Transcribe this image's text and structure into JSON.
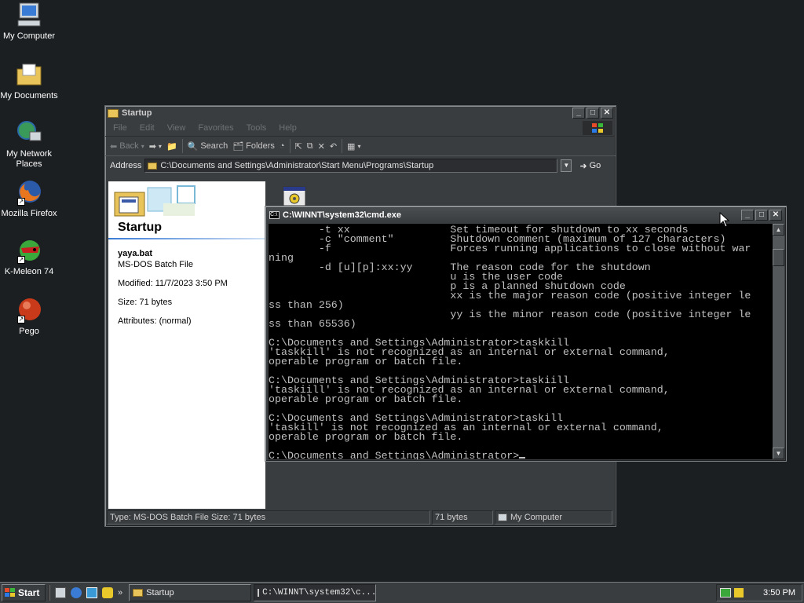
{
  "desktop": {
    "icons": [
      {
        "label": "My Computer"
      },
      {
        "label": "My Documents"
      },
      {
        "label": "My Network Places"
      },
      {
        "label": "Mozilla Firefox"
      },
      {
        "label": "K-Meleon 74"
      },
      {
        "label": "Pego"
      }
    ]
  },
  "explorer": {
    "title": "Startup",
    "menu": [
      "File",
      "Edit",
      "View",
      "Favorites",
      "Tools",
      "Help"
    ],
    "toolbar": {
      "back": "Back",
      "search": "Search",
      "folders": "Folders"
    },
    "address_label": "Address",
    "address_value": "C:\\Documents and Settings\\Administrator\\Start Menu\\Programs\\Startup",
    "go_label": "Go",
    "pane": {
      "folder_title": "Startup",
      "file_name": "yaya.bat",
      "file_type": "MS-DOS Batch File",
      "modified": "Modified: 11/7/2023 3:50 PM",
      "size": "Size: 71 bytes",
      "attributes": "Attributes: (normal)"
    },
    "status": {
      "description": "Type: MS-DOS Batch File Size: 71 bytes",
      "size": "71 bytes",
      "zone": "My Computer"
    }
  },
  "cmd": {
    "title": "C:\\WINNT\\system32\\cmd.exe",
    "lines": [
      "        -t xx                Set timeout for shutdown to xx seconds",
      "        -c \"comment\"         Shutdown comment (maximum of 127 characters)",
      "        -f                   Forces running applications to close without war",
      "ning",
      "        -d [u][p]:xx:yy      The reason code for the shutdown",
      "                             u is the user code",
      "                             p is a planned shutdown code",
      "                             xx is the major reason code (positive integer le",
      "ss than 256)",
      "                             yy is the minor reason code (positive integer le",
      "ss than 65536)",
      "",
      "C:\\Documents and Settings\\Administrator>taskkill",
      "'taskkill' is not recognized as an internal or external command,",
      "operable program or batch file.",
      "",
      "C:\\Documents and Settings\\Administrator>taskiill",
      "'taskiill' is not recognized as an internal or external command,",
      "operable program or batch file.",
      "",
      "C:\\Documents and Settings\\Administrator>taskill",
      "'taskill' is not recognized as an internal or external command,",
      "operable program or batch file.",
      "",
      "C:\\Documents and Settings\\Administrator>"
    ]
  },
  "taskbar": {
    "start_label": "Start",
    "tasks": [
      {
        "label": "Startup"
      },
      {
        "label": "C:\\WINNT\\system32\\c..."
      }
    ],
    "clock": "3:50 PM"
  },
  "colors": {
    "desktop": "#1b1f22",
    "console_bg": "#000000",
    "console_fg": "#c0c0c0"
  }
}
